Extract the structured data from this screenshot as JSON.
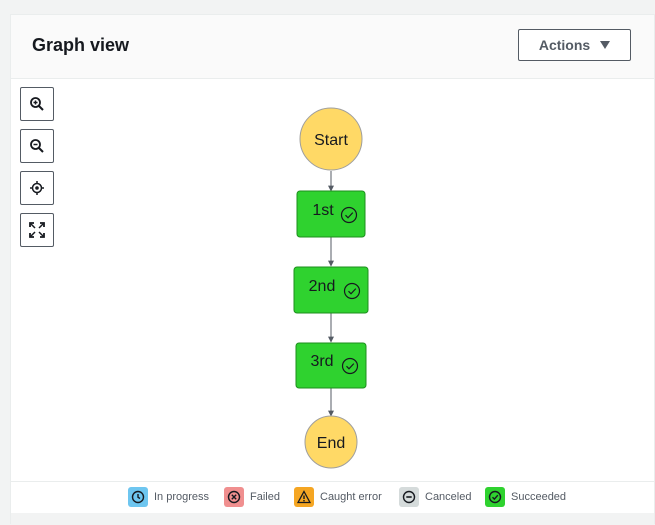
{
  "header": {
    "title": "Graph view",
    "actions_label": "Actions"
  },
  "controls": {
    "icons": [
      "zoom-in-icon",
      "zoom-out-icon",
      "center-icon",
      "fit-screen-icon"
    ]
  },
  "graph": {
    "nodes": [
      {
        "id": "start",
        "label": "Start",
        "kind": "terminal",
        "color": "#ffd966"
      },
      {
        "id": "first",
        "label": "1st",
        "kind": "state",
        "status": "succeeded",
        "color": "#2fd22f"
      },
      {
        "id": "second",
        "label": "2nd",
        "kind": "state",
        "status": "succeeded",
        "color": "#2fd22f"
      },
      {
        "id": "third",
        "label": "3rd",
        "kind": "state",
        "status": "succeeded",
        "color": "#2fd22f"
      },
      {
        "id": "end",
        "label": "End",
        "kind": "terminal",
        "color": "#ffd966"
      }
    ]
  },
  "legend": {
    "items": [
      {
        "label": "In progress",
        "color": "#6ec6f0",
        "icon": "clock-icon"
      },
      {
        "label": "Failed",
        "color": "#f08f8f",
        "icon": "x-circle-icon"
      },
      {
        "label": "Caught error",
        "color": "#f5a623",
        "icon": "warning-icon"
      },
      {
        "label": "Canceled",
        "color": "#d5dbdb",
        "icon": "minus-circle-icon"
      },
      {
        "label": "Succeeded",
        "color": "#2fd22f",
        "icon": "check-circle-icon"
      }
    ]
  }
}
